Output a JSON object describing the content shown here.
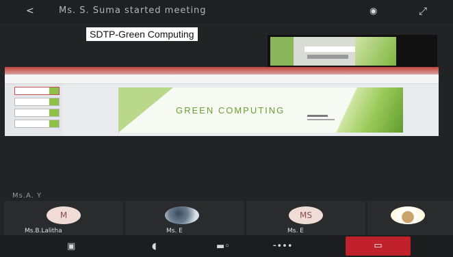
{
  "topbar": {
    "back_icon": "chevron-left-icon",
    "back_glyph": "<",
    "title": "Ms. S. Suma started meeting",
    "audio_icon": "audio-output-icon",
    "audio_glyph": "◉",
    "leave_icon": "share-icon",
    "leave_glyph": "⤢"
  },
  "share": {
    "label": "SDTP-Green Computing"
  },
  "presentation": {
    "slide_title": "GREEN COMPUTING",
    "theme_colors": {
      "ribbon": "#c2453e",
      "green": "#8dbf4a",
      "dark_green": "#5f9d2e"
    }
  },
  "participants": {
    "section_label": "Ms.A. Y",
    "tiles": [
      {
        "initials": "M",
        "name": "Ms.B.Lalitha",
        "avatar_type": "initials"
      },
      {
        "initials": "",
        "name": "Ms. E",
        "avatar_type": "photo"
      },
      {
        "initials": "MS",
        "name": "Ms. E",
        "avatar_type": "initials"
      },
      {
        "initials": "",
        "name": "",
        "avatar_type": "photo"
      }
    ]
  },
  "controls": {
    "camera_icon": "video-camera-icon",
    "camera_glyph": "▣",
    "mic_icon": "microphone-icon",
    "mic_glyph": "◖",
    "speaker_icon": "speaker-icon",
    "speaker_glyph": "▬◦",
    "more_icon": "more-options-icon",
    "more_glyph": "⁃•••",
    "end_icon": "end-call-icon",
    "end_glyph": "▭",
    "end_color": "#c0212a"
  }
}
